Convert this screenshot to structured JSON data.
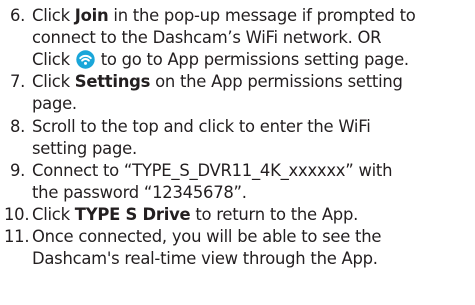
{
  "steps": [
    {
      "number": "6.",
      "line1_before": "Click ",
      "line1_bold": "Join",
      "line1_after": " in the pop-up message if prompted to",
      "line2": "connect to the Dashcam’s WiFi network. OR",
      "line3_before": "Click ",
      "line3_icon": "wifi-settings-icon",
      "line3_after": " to go to App permissions setting page."
    },
    {
      "number": "7.",
      "line1_before": "Click ",
      "line1_bold": "Settings",
      "line1_after": " on the App permissions setting",
      "line2": "page."
    },
    {
      "number": "8.",
      "line1": "Scroll to the top and click to enter the WiFi",
      "line2": "setting page."
    },
    {
      "number": "9.",
      "line1": "Connect to “TYPE_S_DVR11_4K_xxxxxx” with",
      "line2": "the password “12345678”."
    },
    {
      "number": "10.",
      "line1_before": "Click ",
      "line1_bold": "TYPE S Drive",
      "line1_after": " to return to the App."
    },
    {
      "number": "11.",
      "line1": "Once connected, you will be able to see the",
      "line2": "Dashcam's real-time view through the App."
    }
  ],
  "colors": {
    "text": "#231f20",
    "icon_bg": "#1aa6d9",
    "icon_fg": "#ffffff"
  }
}
